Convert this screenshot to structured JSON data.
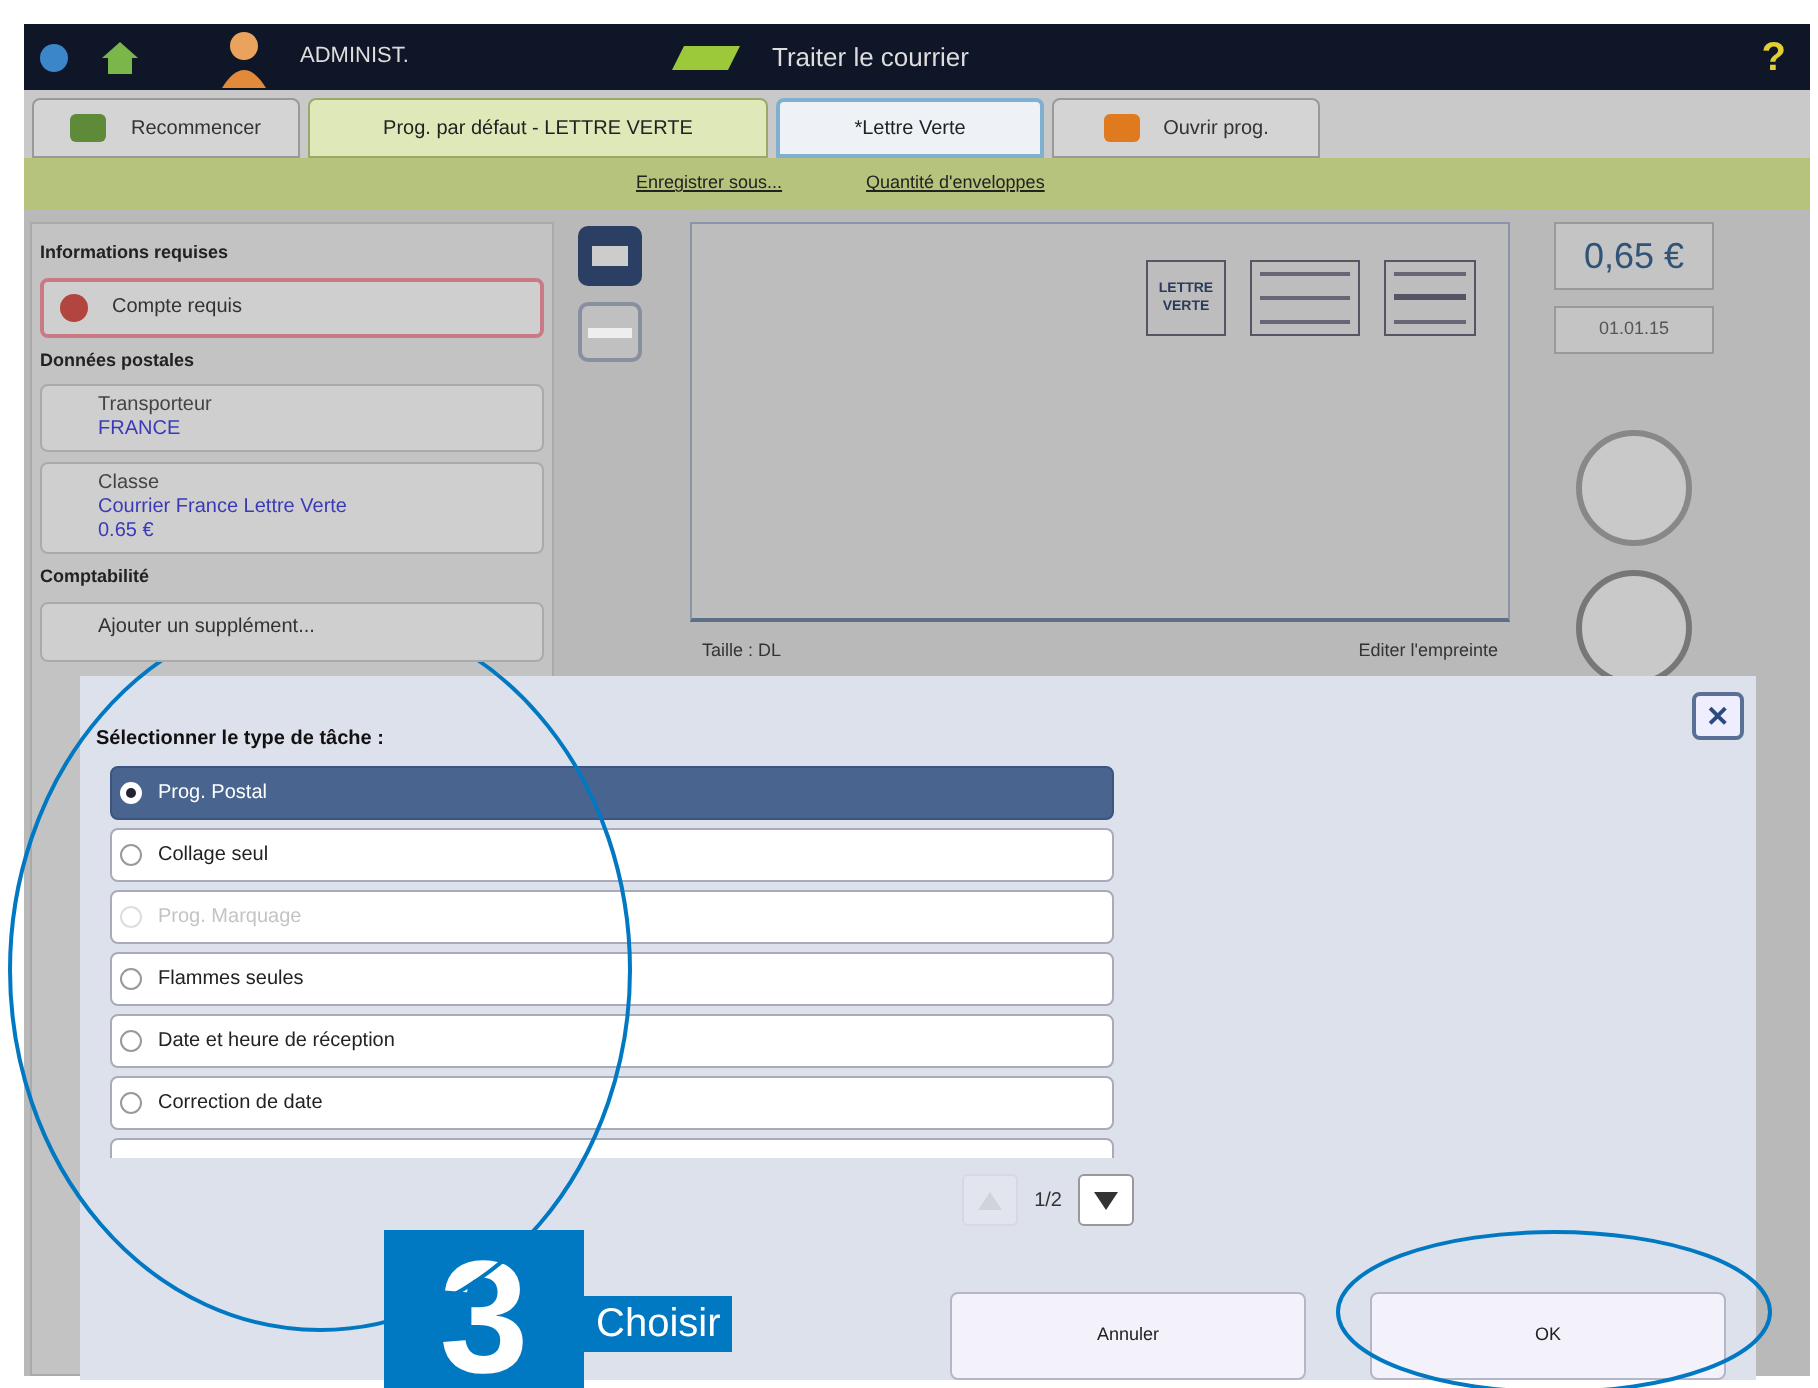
{
  "header": {
    "user": "ADMINIST.",
    "title": "Traiter le courrier",
    "help": "?"
  },
  "tabs": [
    {
      "label": "Recommencer",
      "kind": "action",
      "selected": false
    },
    {
      "label": "Prog. par défaut - LETTRE  VERTE",
      "kind": "tab",
      "selected": true
    },
    {
      "label": "*Lettre Verte",
      "kind": "tab",
      "selected": false
    },
    {
      "label": "Ouvrir prog.",
      "kind": "action",
      "selected": false
    }
  ],
  "toolbar_links": [
    {
      "label": "Enregistrer sous...",
      "disabled": false
    },
    {
      "label": "Quantité d'enveloppes",
      "disabled": false
    }
  ],
  "left_panel": {
    "sections": [
      {
        "title": "Informations requises",
        "items": [
          {
            "kind": "error",
            "label": "Compte requis"
          }
        ]
      },
      {
        "title": "Données postales",
        "items": [
          {
            "kind": "field",
            "label": "Transporteur",
            "values": [
              "FRANCE"
            ]
          },
          {
            "kind": "field",
            "label": "Classe",
            "values": [
              "Courrier France Lettre Verte",
              "0.65 €"
            ]
          }
        ]
      },
      {
        "title": "Comptabilité",
        "items": [
          {
            "kind": "plain",
            "label": "Ajouter un supplément..."
          }
        ]
      }
    ]
  },
  "preview": {
    "stamp_label": "LETTRE VERTE",
    "size": "Taille : DL",
    "edit": "Editer l'empreinte"
  },
  "summary": {
    "price": "0,65 €",
    "date": "01.01.15"
  },
  "dialog": {
    "title": "Sélectionner le type de tâche :",
    "close": "✕",
    "options": [
      {
        "label": "Prog. Postal",
        "selected": true,
        "disabled": false
      },
      {
        "label": "Collage seul",
        "selected": false,
        "disabled": false
      },
      {
        "label": "Prog. Marquage",
        "selected": false,
        "disabled": true
      },
      {
        "label": "Flammes seules",
        "selected": false,
        "disabled": false
      },
      {
        "label": "Date et heure de réception",
        "selected": false,
        "disabled": false
      },
      {
        "label": "Correction de date",
        "selected": false,
        "disabled": false
      }
    ],
    "page": "1/2",
    "page_up_disabled": true,
    "buttons": [
      "Annuler",
      "OK"
    ]
  },
  "annotation": {
    "step": "3",
    "label": "Choisir"
  }
}
